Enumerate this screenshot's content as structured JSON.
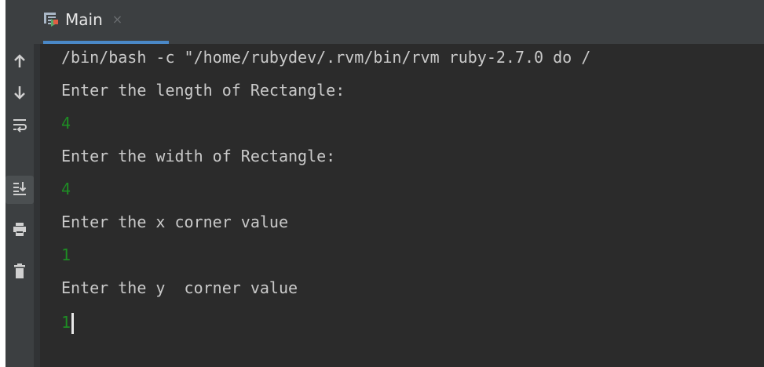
{
  "tab": {
    "label": "Main",
    "close": "×",
    "icon": "run-config-icon"
  },
  "sidebar": [
    {
      "name": "scroll-up-icon",
      "glyph": "↑"
    },
    {
      "name": "scroll-down-icon",
      "glyph": "↓"
    },
    {
      "name": "soft-wrap-icon",
      "glyph": "soft-wrap"
    },
    {
      "name": "scroll-to-end-icon",
      "glyph": "scroll-to-end"
    },
    {
      "name": "print-icon",
      "glyph": "print"
    },
    {
      "name": "clear-all-icon",
      "glyph": "trash"
    }
  ],
  "console": {
    "lines": [
      {
        "type": "out",
        "text": "/bin/bash -c \"/home/rubydev/.rvm/bin/rvm ruby-2.7.0 do /"
      },
      {
        "type": "out",
        "text": "Enter the length of Rectangle:"
      },
      {
        "type": "in",
        "text": "4"
      },
      {
        "type": "out",
        "text": "Enter the width of Rectangle:"
      },
      {
        "type": "in",
        "text": "4"
      },
      {
        "type": "out",
        "text": "Enter the x corner value"
      },
      {
        "type": "in",
        "text": "1"
      },
      {
        "type": "out",
        "text": "Enter the y  corner value"
      },
      {
        "type": "in",
        "text": "1"
      }
    ]
  },
  "colors": {
    "background": "#2b2b2b",
    "panel": "#3c3f41",
    "output_text": "#c9c9c9",
    "input_text": "#1e8c24",
    "tab_accent": "#4a88c7"
  }
}
